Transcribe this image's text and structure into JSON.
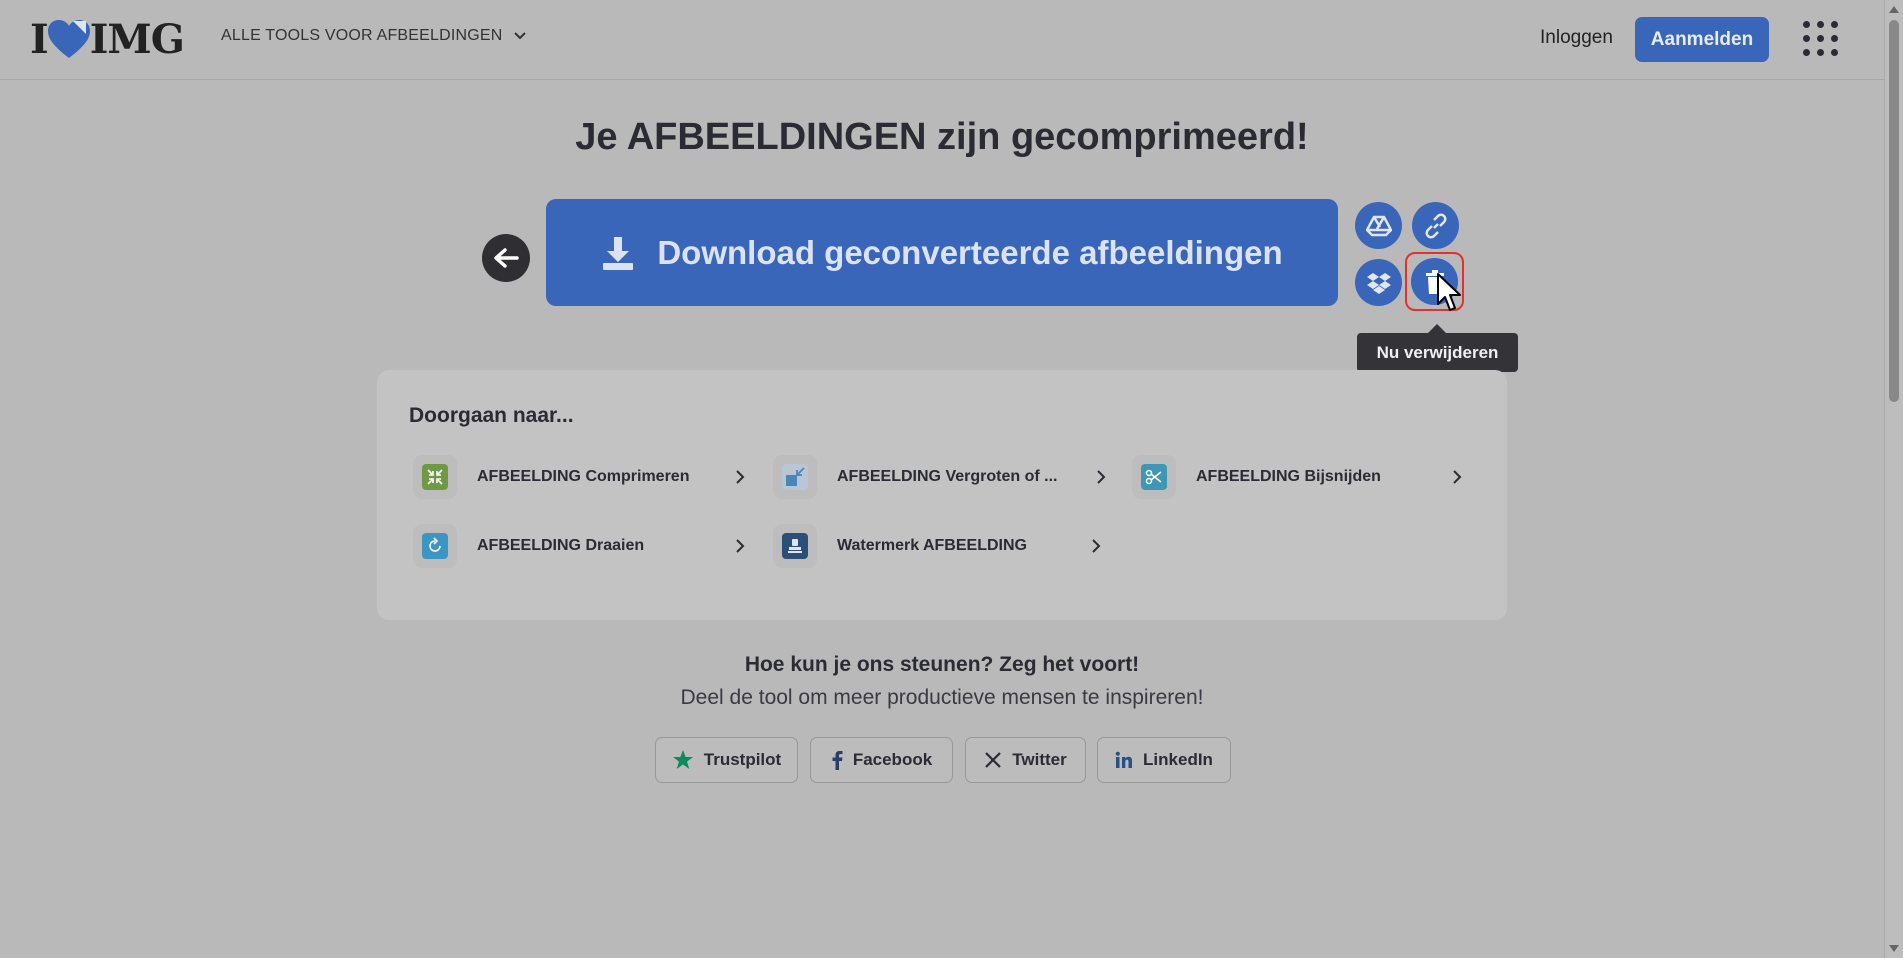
{
  "header": {
    "logo_left": "I",
    "logo_right": "IMG",
    "tools_menu": "ALLE TOOLS VOOR AFBEELDINGEN",
    "login": "Inloggen",
    "signup": "Aanmelden"
  },
  "main": {
    "title": "Je AFBEELDINGEN zijn gecomprimeerd!",
    "download_label": "Download geconverteerde afbeeldingen",
    "tooltip": "Nu verwijderen"
  },
  "continue": {
    "heading": "Doorgaan naar...",
    "tools": [
      {
        "label": "AFBEELDING Comprimeren",
        "color": "#6f9a45"
      },
      {
        "label": "AFBEELDING Vergroten of ...",
        "color": "#4a86b8"
      },
      {
        "label": "AFBEELDING Bijsnijden",
        "color": "#3f97b5"
      },
      {
        "label": "AFBEELDING Draaien",
        "color": "#3b97c2"
      },
      {
        "label": "Watermerk AFBEELDING",
        "color": "#2c4f7a"
      }
    ]
  },
  "support": {
    "title": "Hoe kun je ons steunen? Zeg het voort!",
    "subtitle": "Deel de tool om meer productieve mensen te inspireren!",
    "buttons": [
      "Trustpilot",
      "Facebook",
      "Twitter",
      "LinkedIn"
    ]
  },
  "colors": {
    "accent": "#3a66b9",
    "highlight": "#e53030"
  }
}
